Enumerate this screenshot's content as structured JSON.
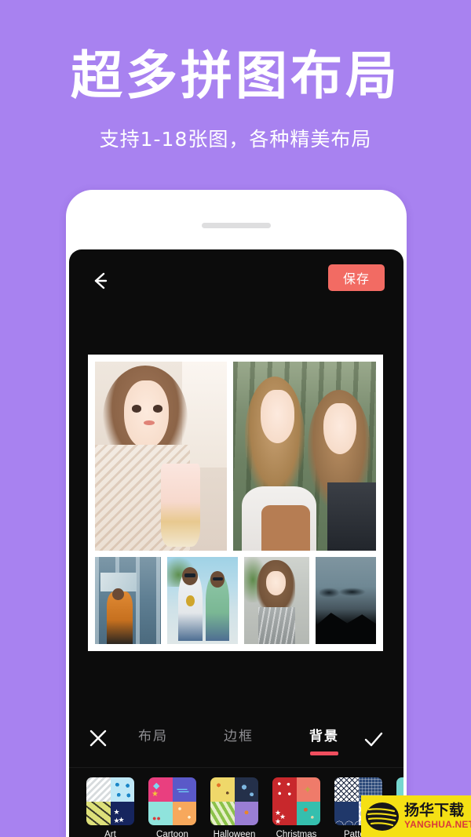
{
  "promo": {
    "headline": "超多拼图布局",
    "subtitle": "支持1-18张图，各种精美布局",
    "background_color": "#a882f0",
    "text_color": "#ffffff"
  },
  "phone": {
    "frame_color": "#ffffff",
    "screen_color": "#0c0c0c",
    "speaker_name": "speaker-grille"
  },
  "app": {
    "topbar": {
      "back_icon": "back-arrow-icon",
      "save_label": "保存",
      "save_color": "#f26b63"
    },
    "canvas": {
      "frame_color": "#ffffff",
      "photos": [
        {
          "name": "photo-portrait-drink",
          "row": "top"
        },
        {
          "name": "photo-two-friends",
          "row": "top"
        },
        {
          "name": "photo-street-orange",
          "row": "bottom"
        },
        {
          "name": "photo-two-sunglasses",
          "row": "bottom"
        },
        {
          "name": "photo-girl-grey-top",
          "row": "bottom"
        },
        {
          "name": "photo-mountain-dusk",
          "row": "bottom"
        }
      ]
    },
    "toolbar": {
      "close_icon": "close-x-icon",
      "confirm_icon": "check-icon",
      "active_color": "#f04e5e",
      "inactive_color": "#8e8e92",
      "tabs": [
        {
          "label": "布局",
          "active": false
        },
        {
          "label": "边框",
          "active": false
        },
        {
          "label": "背景",
          "active": true
        }
      ]
    },
    "backgrounds": {
      "items": [
        {
          "label": "Art"
        },
        {
          "label": "Cartoon"
        },
        {
          "label": "Halloween"
        },
        {
          "label": "Christmas"
        },
        {
          "label": "Pattern"
        },
        {
          "label": ""
        }
      ]
    }
  },
  "watermark": {
    "cn": "扬华下载",
    "en": "YANGHUA.NET",
    "bg_color": "#f5e014",
    "cn_color": "#17161a",
    "en_color": "#d93a3a"
  }
}
